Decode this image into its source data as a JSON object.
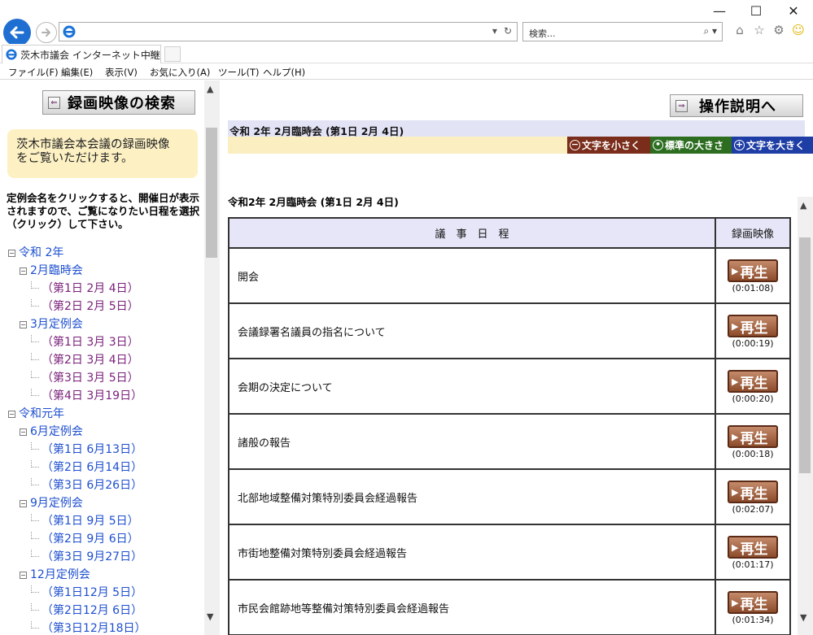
{
  "browser": {
    "window_controls": {
      "minimize": "—",
      "maximize": "☐",
      "close": "✕"
    },
    "address": "",
    "search_placeholder": "検索...",
    "tab_title": "茨木市議会 インターネット中継",
    "menu": [
      "ファイル(F)",
      "編集(E)",
      "表示(V)",
      "お気に入り(A)",
      "ツール(T)",
      "ヘルプ(H)"
    ],
    "toolbar_icons": [
      "home-icon",
      "star-icon",
      "gear-icon",
      "smiley-icon"
    ]
  },
  "left": {
    "search_header": "録画映像の検索",
    "info_text_1": "茨木市議会本会議の録画映像",
    "info_text_2": "をご覧いただけます。",
    "note": "定例会名をクリックすると、開催日が表示されますので、ご覧になりたい日程を選択（クリック）して下さい。",
    "tree": [
      {
        "label": "令和 2年",
        "level": 0,
        "color": "blue"
      },
      {
        "label": "2月臨時会",
        "level": 1,
        "color": "blue"
      },
      {
        "label": "（第1日  2月  4日）",
        "level": 2,
        "color": "purple"
      },
      {
        "label": "（第2日  2月  5日）",
        "level": 2,
        "color": "purple"
      },
      {
        "label": "3月定例会",
        "level": 1,
        "color": "blue"
      },
      {
        "label": "（第1日  3月  3日）",
        "level": 2,
        "color": "purple"
      },
      {
        "label": "（第2日  3月  4日）",
        "level": 2,
        "color": "purple"
      },
      {
        "label": "（第3日  3月  5日）",
        "level": 2,
        "color": "purple"
      },
      {
        "label": "（第4日  3月19日）",
        "level": 2,
        "color": "purple"
      },
      {
        "label": "令和元年",
        "level": 0,
        "color": "blue"
      },
      {
        "label": "6月定例会",
        "level": 1,
        "color": "blue"
      },
      {
        "label": "（第1日  6月13日）",
        "level": 2,
        "color": "blue"
      },
      {
        "label": "（第2日  6月14日）",
        "level": 2,
        "color": "blue"
      },
      {
        "label": "（第3日  6月26日）",
        "level": 2,
        "color": "blue"
      },
      {
        "label": "9月定例会",
        "level": 1,
        "color": "blue"
      },
      {
        "label": "（第1日  9月  5日）",
        "level": 2,
        "color": "blue"
      },
      {
        "label": "（第2日  9月  6日）",
        "level": 2,
        "color": "blue"
      },
      {
        "label": "（第3日  9月27日）",
        "level": 2,
        "color": "blue"
      },
      {
        "label": "12月定例会",
        "level": 1,
        "color": "blue"
      },
      {
        "label": "（第1日12月  5日）",
        "level": 2,
        "color": "blue"
      },
      {
        "label": "（第2日12月  6日）",
        "level": 2,
        "color": "blue"
      },
      {
        "label": "（第3日12月18日）",
        "level": 2,
        "color": "blue"
      }
    ]
  },
  "right": {
    "help_button": "操作説明へ",
    "date_header": "令和 2年 2月臨時会 (第1日  2月  4日)",
    "font_size": {
      "smaller": "文字を小さく",
      "standard": "標準の大きさ",
      "larger": "文字を大きく"
    },
    "section_title": "令和2年  2月臨時会 (第1日  2月  4日)",
    "table_headers": {
      "agenda": "議　事　日　程",
      "video": "録画映像"
    },
    "play_label": "再生",
    "rows": [
      {
        "item": "開会",
        "duration": "(0:01:08)"
      },
      {
        "item": "会議録署名議員の指名について",
        "duration": "(0:00:19)"
      },
      {
        "item": "会期の決定について",
        "duration": "(0:00:20)"
      },
      {
        "item": "諸般の報告",
        "duration": "(0:00:18)"
      },
      {
        "item": "北部地域整備対策特別委員会経過報告",
        "duration": "(0:02:07)"
      },
      {
        "item": "市街地整備対策特別委員会経過報告",
        "duration": "(0:01:17)"
      },
      {
        "item": "市民会館跡地等整備対策特別委員会経過報告",
        "duration": "(0:01:34)"
      }
    ]
  },
  "colors": {
    "tree_blue": "#1d4fcf",
    "tree_purple": "#7a207a",
    "size_small": "#7a2d1a",
    "size_standard": "#2c6d20",
    "size_large": "#1f3ea5"
  }
}
